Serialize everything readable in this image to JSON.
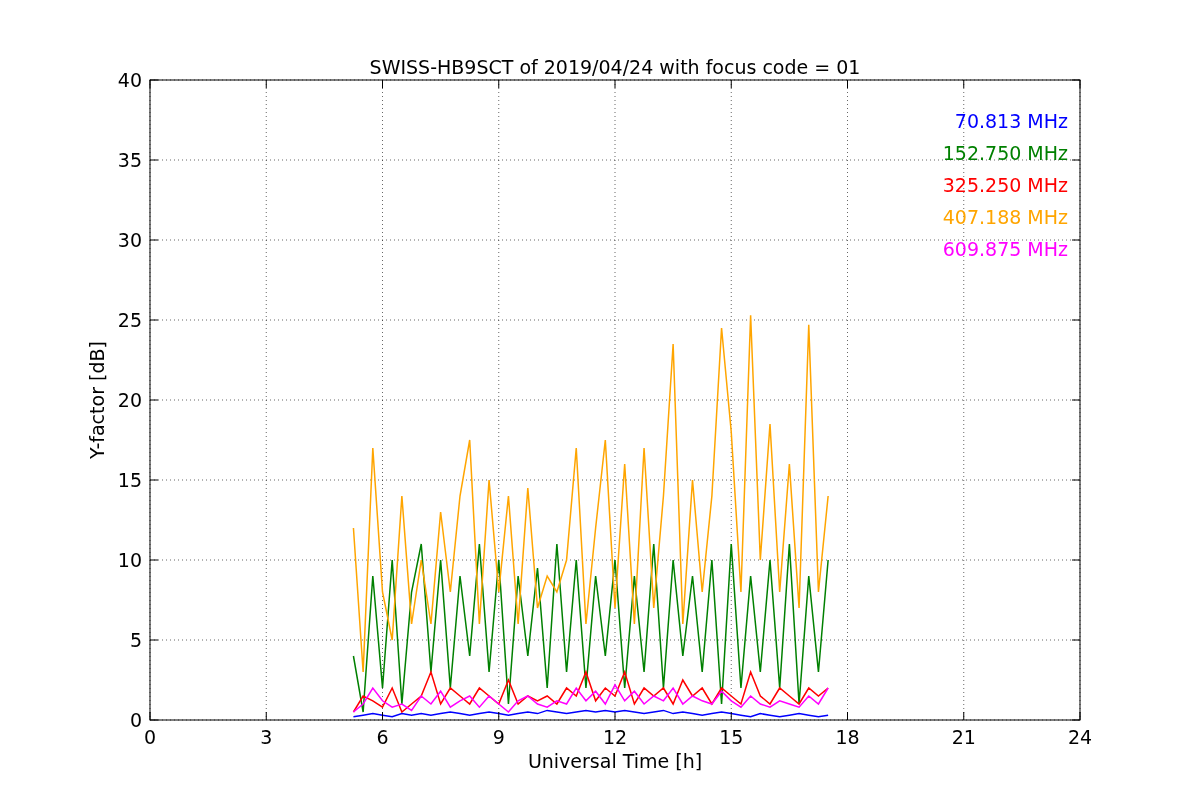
{
  "chart_data": {
    "type": "line",
    "title": "SWISS-HB9SCT of 2019/04/24 with focus code = 01",
    "xlabel": "Universal Time [h]",
    "ylabel": "Y-factor [dB]",
    "x": [
      5.25,
      5.5,
      5.75,
      6.0,
      6.25,
      6.5,
      6.75,
      7.0,
      7.25,
      7.5,
      7.75,
      8.0,
      8.25,
      8.5,
      8.75,
      9.0,
      9.25,
      9.5,
      9.75,
      10.0,
      10.25,
      10.5,
      10.75,
      11.0,
      11.25,
      11.5,
      11.75,
      12.0,
      12.25,
      12.5,
      12.75,
      13.0,
      13.25,
      13.5,
      13.75,
      14.0,
      14.25,
      14.5,
      14.75,
      15.0,
      15.25,
      15.5,
      15.75,
      16.0,
      16.25,
      16.5,
      16.75,
      17.0,
      17.25,
      17.5
    ],
    "series": [
      {
        "name": "70.813 MHz",
        "color": "#0000ff",
        "values": [
          0.2,
          0.3,
          0.4,
          0.3,
          0.2,
          0.4,
          0.3,
          0.4,
          0.3,
          0.4,
          0.5,
          0.4,
          0.3,
          0.4,
          0.5,
          0.4,
          0.3,
          0.4,
          0.5,
          0.4,
          0.6,
          0.5,
          0.4,
          0.5,
          0.6,
          0.5,
          0.6,
          0.5,
          0.6,
          0.5,
          0.4,
          0.5,
          0.6,
          0.4,
          0.5,
          0.4,
          0.3,
          0.4,
          0.5,
          0.4,
          0.3,
          0.2,
          0.4,
          0.3,
          0.2,
          0.3,
          0.4,
          0.3,
          0.2,
          0.3
        ]
      },
      {
        "name": "152.750 MHz",
        "color": "#008000",
        "values": [
          4,
          0.5,
          9,
          2,
          10,
          1,
          8,
          11,
          3,
          10,
          2,
          9,
          4,
          11,
          3,
          10,
          1,
          9,
          4,
          9.5,
          2,
          11,
          3,
          10,
          2,
          9,
          4,
          10,
          2,
          9,
          3,
          11,
          2,
          10,
          4,
          9,
          3,
          10,
          1,
          11,
          2,
          9,
          3,
          10,
          2,
          11,
          1,
          9,
          3,
          10
        ]
      },
      {
        "name": "325.250 MHz",
        "color": "#ff0000",
        "values": [
          0.5,
          1.5,
          1.2,
          0.8,
          2,
          0.5,
          1,
          1.5,
          3,
          1,
          2,
          1.5,
          1,
          2,
          1.5,
          1,
          2.5,
          1,
          1.5,
          1.2,
          1.5,
          1,
          2,
          1.5,
          3,
          1.2,
          2,
          1.5,
          3,
          1,
          2,
          1.5,
          2,
          1,
          2.5,
          1.5,
          2,
          1,
          2,
          1.5,
          1,
          3,
          1.5,
          1,
          2,
          1.5,
          1,
          2,
          1.5,
          2
        ]
      },
      {
        "name": "407.188 MHz",
        "color": "#ffa500",
        "values": [
          12,
          3,
          17,
          8,
          5,
          14,
          6,
          10,
          6,
          13,
          8,
          14,
          17.5,
          6,
          15,
          8,
          14,
          6,
          14.5,
          7,
          9,
          8,
          10,
          17,
          6,
          12,
          17.5,
          7,
          16,
          6,
          17,
          7,
          14,
          23.5,
          6,
          15,
          8,
          14,
          24.5,
          18,
          8,
          25.3,
          10,
          18.5,
          8,
          16,
          7,
          24.7,
          8,
          14
        ]
      },
      {
        "name": "609.875 MHz",
        "color": "#ff00ff",
        "values": [
          0.5,
          1,
          2,
          1.2,
          0.8,
          1,
          0.6,
          1.5,
          1,
          1.8,
          0.8,
          1.2,
          1.5,
          0.8,
          1.5,
          1,
          0.5,
          1.2,
          1.5,
          1,
          0.8,
          1.2,
          1,
          2,
          1.2,
          1.8,
          1,
          2.2,
          1.2,
          1.8,
          1,
          1.5,
          1.2,
          2,
          1,
          1.5,
          1.2,
          1,
          1.8,
          1.2,
          0.8,
          1.5,
          1,
          0.8,
          1.2,
          1,
          0.8,
          1.5,
          1,
          2
        ]
      }
    ],
    "grid": true,
    "xlim": [
      0,
      24
    ],
    "ylim": [
      0,
      40
    ],
    "xticks": [
      0,
      3,
      6,
      9,
      12,
      15,
      18,
      21,
      24
    ],
    "yticks": [
      0,
      5,
      10,
      15,
      20,
      25,
      30,
      35,
      40
    ]
  }
}
